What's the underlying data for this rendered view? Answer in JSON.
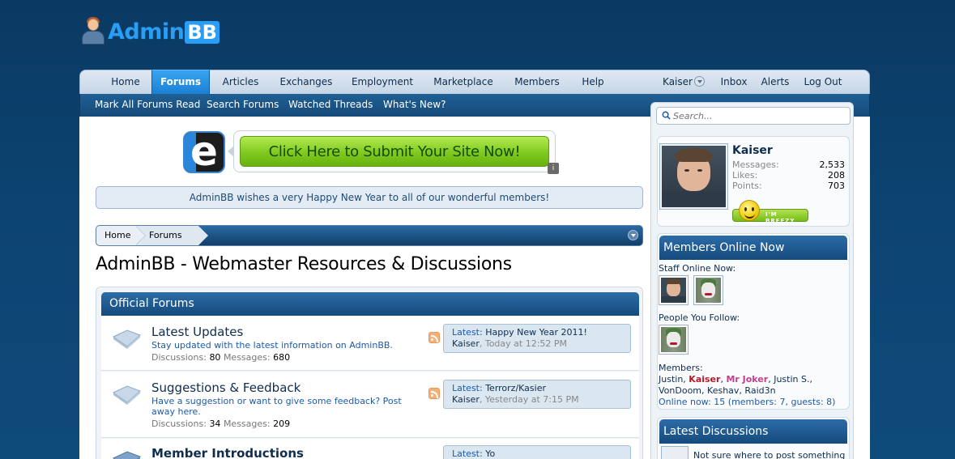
{
  "logo": {
    "part1": "Admin",
    "part2": "BB"
  },
  "nav": {
    "tabs": [
      {
        "label": "Home"
      },
      {
        "label": "Forums"
      },
      {
        "label": "Articles"
      },
      {
        "label": "Exchanges"
      },
      {
        "label": "Employment"
      },
      {
        "label": "Marketplace"
      },
      {
        "label": "Members"
      },
      {
        "label": "Help"
      }
    ],
    "user": "Kaiser",
    "inbox": "Inbox",
    "alerts": "Alerts",
    "logout": "Log Out"
  },
  "subnav": {
    "items": [
      {
        "label": "Mark All Forums Read"
      },
      {
        "label": "Search Forums"
      },
      {
        "label": "Watched Threads"
      },
      {
        "label": "What's New?"
      }
    ]
  },
  "search": {
    "placeholder": "Search..."
  },
  "banner": {
    "cta": "Click Here to Submit Your Site Now!",
    "letter": "e",
    "info": "i"
  },
  "notice": "AdminBB wishes a very Happy New Year to all of our wonderful members!",
  "breadcrumb": {
    "home": "Home",
    "forums": "Forums"
  },
  "page_title": "AdminBB - Webmaster Resources & Discussions",
  "category": "Official Forums",
  "forums": [
    {
      "title": "Latest Updates",
      "description": "Stay updated with the latest information on AdminBB.",
      "discussions_label": "Discussions:",
      "discussions": "80",
      "messages_label": "Messages:",
      "messages": "680",
      "latest_label": "Latest:",
      "latest_title": "Happy New Year 2011!",
      "latest_user": "Kaiser",
      "latest_time": "Today at 12:52 PM"
    },
    {
      "title": "Suggestions & Feedback",
      "description": "Have a suggestion or want to give some feedback? Post away here.",
      "discussions_label": "Discussions:",
      "discussions": "34",
      "messages_label": "Messages:",
      "messages": "209",
      "latest_label": "Latest:",
      "latest_title": "Terrorz/Kasier",
      "latest_user": "Kaiser",
      "latest_time": "Yesterday at 7:15 PM"
    },
    {
      "title": "Member Introductions",
      "latest_label": "Latest:",
      "latest_title": "Yo"
    }
  ],
  "visitor": {
    "name": "Kaiser",
    "stats": [
      {
        "label": "Messages:",
        "value": "2,533"
      },
      {
        "label": "Likes:",
        "value": "208"
      },
      {
        "label": "Points:",
        "value": "703"
      }
    ],
    "mood": "I'M BREEZY"
  },
  "members_online": {
    "heading": "Members Online Now",
    "staff_label": "Staff Online Now:",
    "follow_label": "People You Follow:",
    "members_label": "Members:",
    "members": [
      {
        "name": "Justin",
        "sep": ", "
      },
      {
        "name": "Kaiser",
        "sep": ", "
      },
      {
        "name": "Mr Joker",
        "sep": ", "
      },
      {
        "name": "Justin S.",
        "sep": ","
      },
      {
        "name": "VonDoom",
        "sep": ", "
      },
      {
        "name": "Keshav",
        "sep": ", "
      },
      {
        "name": "Raid3n",
        "sep": ""
      }
    ],
    "online_now": "Online now: 15 (members: 7, guests: 8)"
  },
  "latest_discussions": {
    "heading": "Latest Discussions",
    "first": "Not sure where to post something"
  }
}
